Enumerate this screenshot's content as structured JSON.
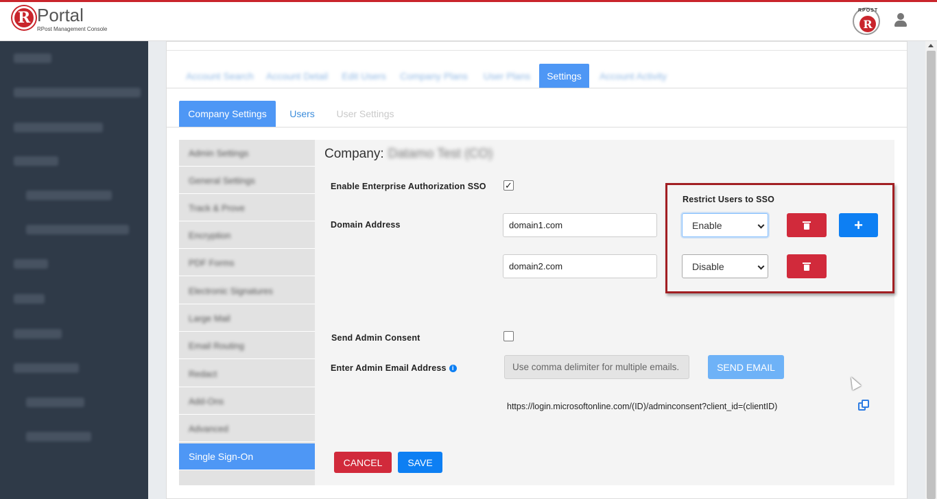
{
  "app": {
    "logo_letter": "R",
    "title": "Portal",
    "subtitle": "RPost Management Console",
    "badge_text": "RPOST",
    "badge_letter": "R"
  },
  "tabs": [
    {
      "label": "Account Search",
      "active": false
    },
    {
      "label": "Account Detail",
      "active": false
    },
    {
      "label": "Edit Users",
      "active": false
    },
    {
      "label": "Company Plans",
      "active": false
    },
    {
      "label": "User Plans",
      "active": false
    },
    {
      "label": "Settings",
      "active": true
    },
    {
      "label": "Account Activity",
      "active": false
    }
  ],
  "subtabs": {
    "company_settings": "Company Settings",
    "users": "Users",
    "user_settings": "User Settings"
  },
  "menu": [
    "Admin Settings",
    "General Settings",
    "Track & Prove",
    "Encryption",
    "PDF Forms",
    "Electronic Signatures",
    "Large Mail",
    "Email Routing",
    "Redact",
    "Add-Ons",
    "Advanced",
    "Single Sign-On"
  ],
  "company": {
    "label": "Company:",
    "name": "Datamo Test (CO)"
  },
  "sso": {
    "enable_label": "Enable Enterprise Authorization SSO",
    "enable_checked": true,
    "check_mark": "✓",
    "domain_label": "Domain Address",
    "restrict_label": "Restrict Users to SSO",
    "domains": [
      {
        "value": "domain1.com",
        "restrict": "Enable"
      },
      {
        "value": "domain2.com",
        "restrict": "Disable"
      }
    ],
    "add_glyph": "+"
  },
  "consent": {
    "send_label": "Send Admin Consent",
    "send_checked": false,
    "email_label": "Enter Admin Email Address",
    "info_glyph": "i",
    "email_placeholder": "Use comma delimiter for multiple emails.",
    "send_button": "SEND EMAIL",
    "url": "https://login.microsoftonline.com/(ID)/adminconsent?client_id=(clientID)"
  },
  "actions": {
    "cancel": "CANCEL",
    "save": "SAVE"
  },
  "colors": {
    "brand_red": "#c9252c",
    "primary_blue": "#4e97f5",
    "danger": "#d12a3b",
    "sidebar": "#2f3a48"
  }
}
